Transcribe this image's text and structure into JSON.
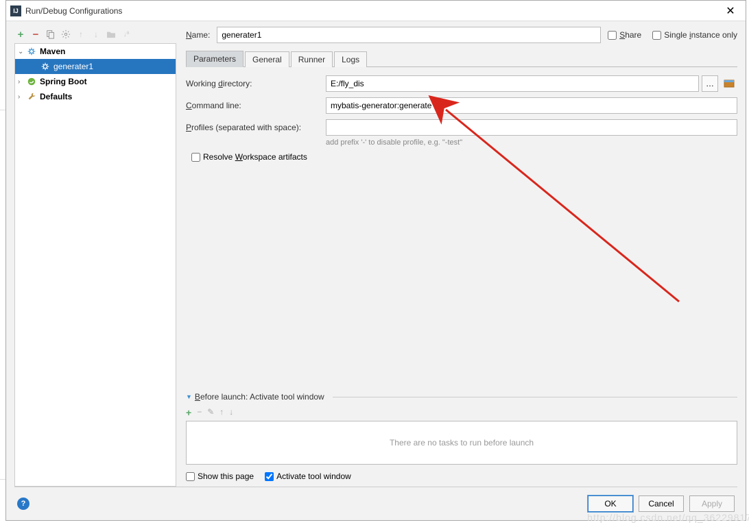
{
  "window": {
    "title": "Run/Debug Configurations"
  },
  "tree": {
    "maven": {
      "label": "Maven",
      "expanded": true,
      "children": [
        {
          "label": "generater1",
          "selected": true
        }
      ]
    },
    "spring": {
      "label": "Spring Boot",
      "expanded": false
    },
    "defaults": {
      "label": "Defaults",
      "expanded": false
    }
  },
  "name": {
    "label": "Name:",
    "value": "generater1"
  },
  "share": {
    "label": "Share",
    "checked": false
  },
  "single_instance": {
    "label": "Single instance only",
    "checked": false
  },
  "tabs": [
    "Parameters",
    "General",
    "Runner",
    "Logs"
  ],
  "active_tab": "Parameters",
  "form": {
    "working_dir": {
      "label": "Working directory:",
      "value": "E:/fly_dis"
    },
    "command_line": {
      "label": "Command line:",
      "value": "mybatis-generator:generate"
    },
    "profiles": {
      "label": "Profiles (separated with space):",
      "value": "",
      "hint": "add prefix '-' to disable profile, e.g. \"-test\""
    },
    "resolve_workspace": {
      "label": "Resolve Workspace artifacts",
      "checked": false
    }
  },
  "before_launch": {
    "title": "Before launch: Activate tool window",
    "empty_text": "There are no tasks to run before launch",
    "show_this_page": {
      "label": "Show this page",
      "checked": false
    },
    "activate_tool_window": {
      "label": "Activate tool window",
      "checked": true
    }
  },
  "buttons": {
    "ok": "OK",
    "cancel": "Cancel",
    "apply": "Apply"
  }
}
